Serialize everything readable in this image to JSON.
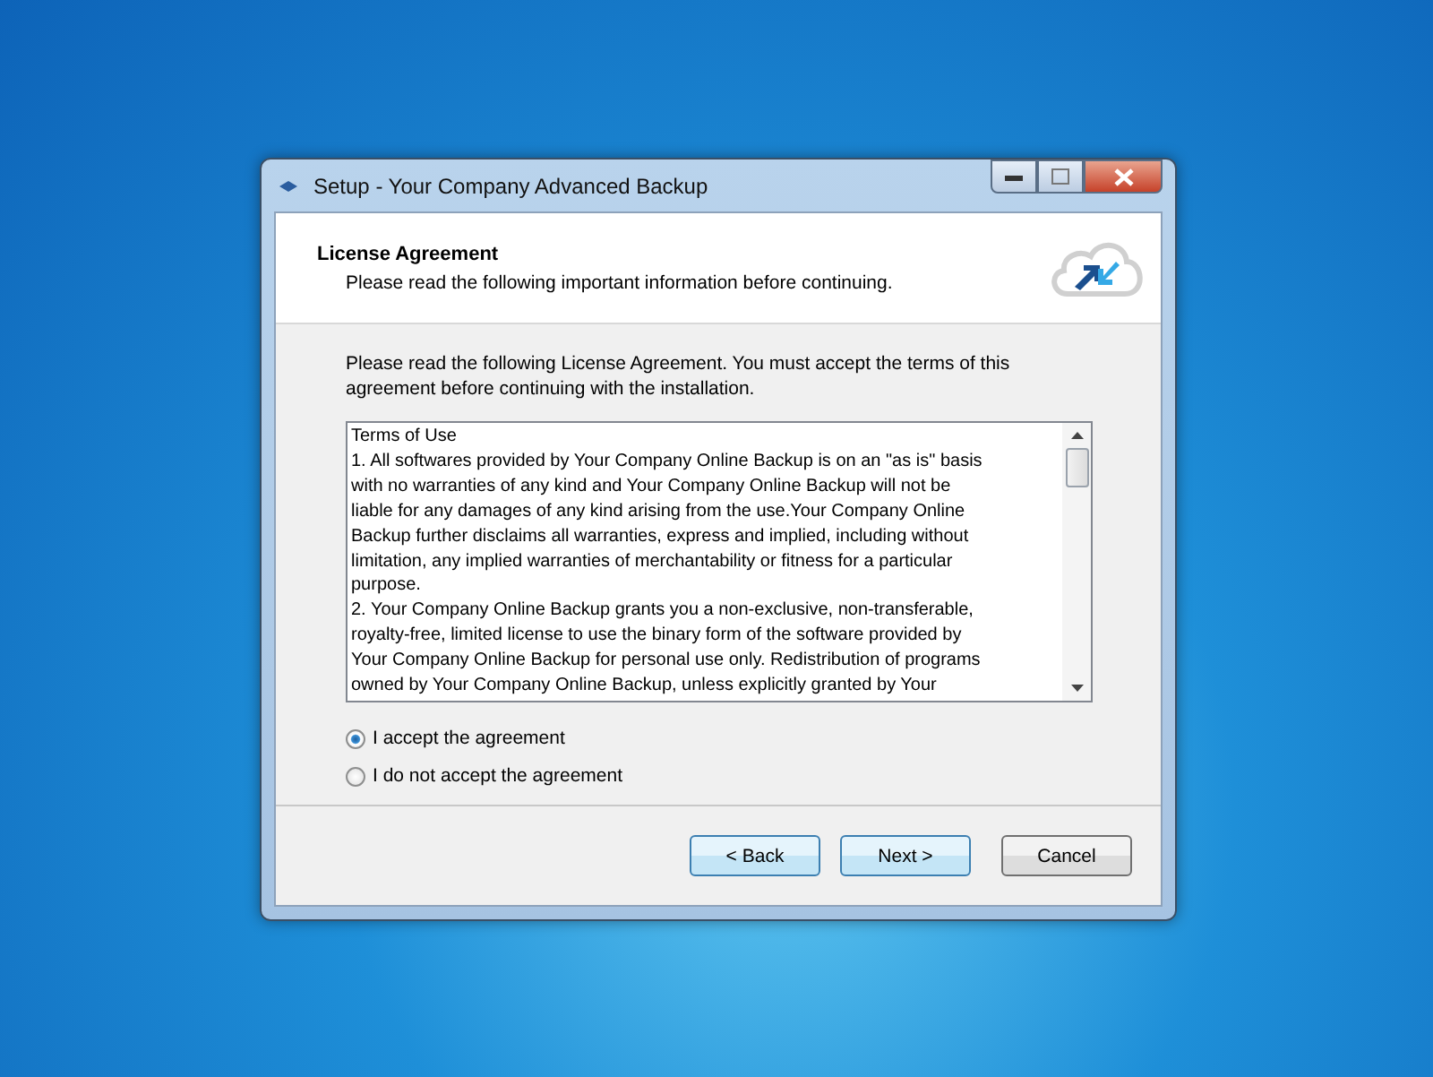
{
  "window": {
    "title": "Setup - Your Company Advanced Backup"
  },
  "header": {
    "title": "License Agreement",
    "subtitle": "Please read the following important information before continuing."
  },
  "intro": "Please read the following License Agreement. You must accept the terms of this agreement before continuing with the installation.",
  "license_lines": [
    "Terms of Use",
    "1. All softwares provided by Your Company Online Backup is on an \"as is\" basis",
    "with no warranties of any kind and Your Company Online Backup will not be",
    "liable for any damages of any kind arising from the use.Your Company Online",
    "Backup further disclaims all warranties, express and implied, including without",
    "limitation, any implied warranties of merchantability or fitness for a particular",
    "purpose.",
    "2. Your Company Online Backup grants you a non-exclusive, non-transferable,",
    "royalty-free, limited license to use the binary form of the software provided by",
    "Your Company Online Backup for personal use only. Redistribution of programs",
    "owned by Your Company Online Backup, unless explicitly granted by Your"
  ],
  "options": [
    {
      "label": "I accept the agreement",
      "selected": true
    },
    {
      "label": "I do not accept the agreement",
      "selected": false
    }
  ],
  "buttons": [
    {
      "label": "< Back",
      "highlighted": true
    },
    {
      "label": "Next >",
      "highlighted": true
    },
    {
      "label": "Cancel",
      "highlighted": false
    }
  ]
}
